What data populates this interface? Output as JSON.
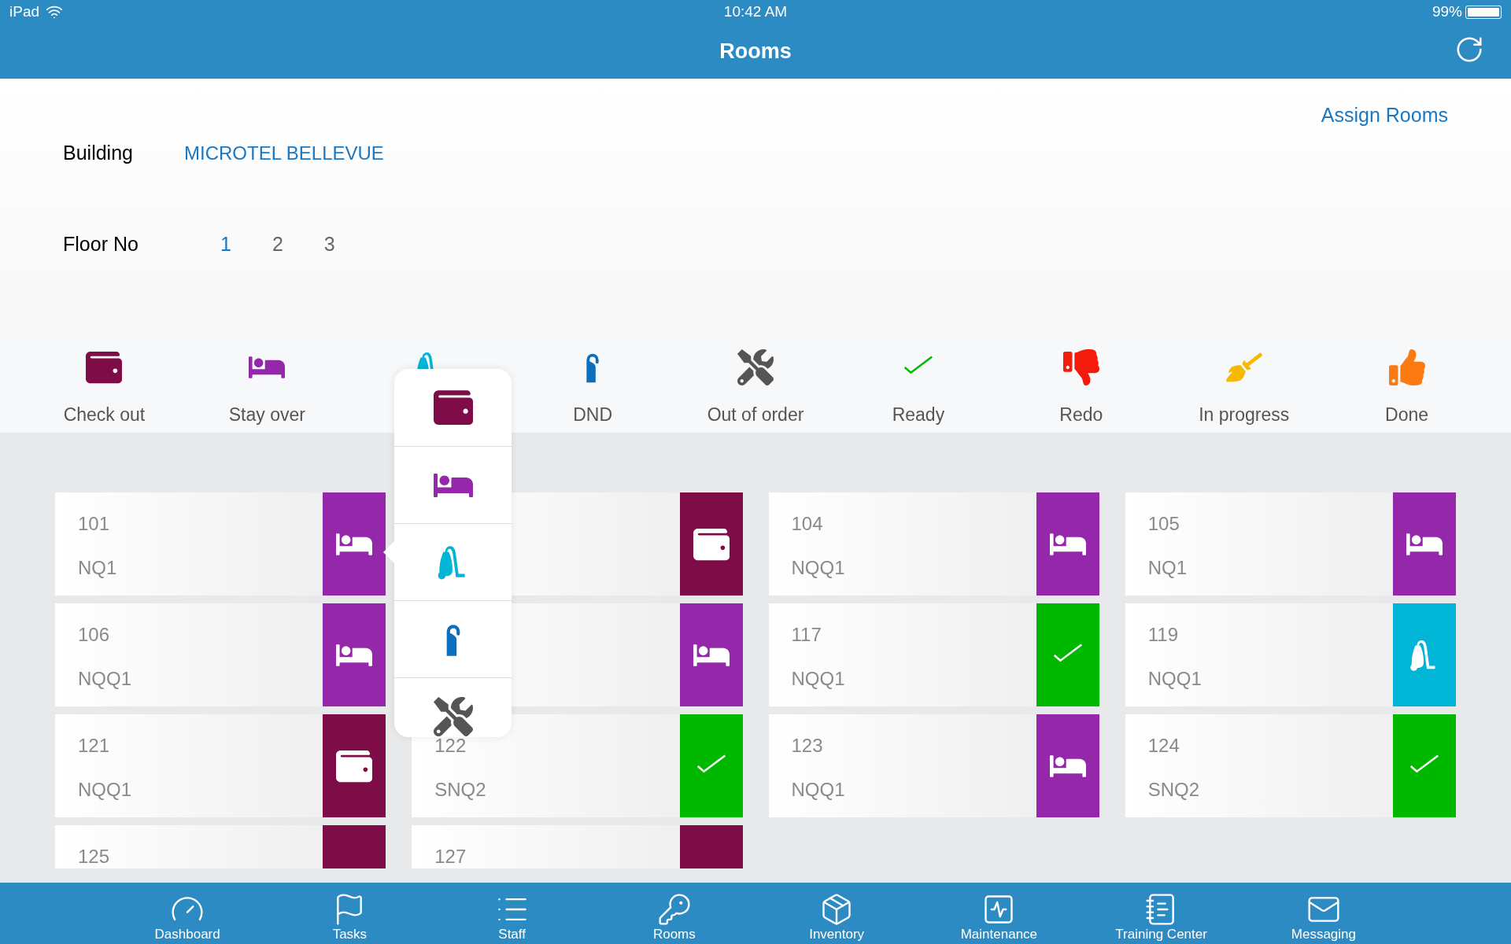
{
  "status_bar": {
    "device": "iPad",
    "time": "10:42 AM",
    "battery": "99%"
  },
  "nav": {
    "title": "Rooms"
  },
  "assign_link": "Assign Rooms",
  "building": {
    "label": "Building",
    "value": "MICROTEL BELLEVUE"
  },
  "floor": {
    "label": "Floor No",
    "options": [
      {
        "label": "1",
        "selected": true
      },
      {
        "label": "2",
        "selected": false
      },
      {
        "label": "3",
        "selected": false
      }
    ]
  },
  "legend": [
    {
      "kind": "checkout",
      "label": "Check out"
    },
    {
      "kind": "stayover",
      "label": "Stay over"
    },
    {
      "kind": "cleaning"
    },
    {
      "kind": "dnd",
      "label": "DND"
    },
    {
      "kind": "out_of_order",
      "label": "Out of order"
    },
    {
      "kind": "ready",
      "label": "Ready"
    },
    {
      "kind": "redo",
      "label": "Redo"
    },
    {
      "kind": "in_progress",
      "label": "In progress"
    },
    {
      "kind": "done",
      "label": "Done"
    }
  ],
  "rooms": [
    {
      "number": "101",
      "type": "NQ1",
      "kind": "stayover"
    },
    {
      "kind": "checkout"
    },
    {
      "number": "104",
      "type": "NQQ1",
      "kind": "stayover"
    },
    {
      "number": "105",
      "type": "NQ1",
      "kind": "stayover"
    },
    {
      "number": "106",
      "type": "NQQ1",
      "kind": "stayover"
    },
    {
      "kind": "stayover"
    },
    {
      "number": "117",
      "type": "NQQ1",
      "kind": "ready"
    },
    {
      "number": "119",
      "type": "NQQ1",
      "kind": "cleaning"
    },
    {
      "number": "121",
      "type": "NQQ1",
      "kind": "checkout"
    },
    {
      "number": "122",
      "type": "SNQ2",
      "kind": "ready"
    },
    {
      "number": "123",
      "type": "NQQ1",
      "kind": "stayover"
    },
    {
      "number": "124",
      "type": "SNQ2",
      "kind": "ready"
    },
    {
      "number": "125",
      "kind": "checkout_cut"
    },
    {
      "number": "127",
      "kind": "checkout_cut"
    }
  ],
  "status_menu": [
    {
      "kind": "checkout"
    },
    {
      "kind": "stayover"
    },
    {
      "kind": "cleaning"
    },
    {
      "kind": "dnd"
    },
    {
      "kind": "out_of_order"
    }
  ],
  "tab_bar": [
    {
      "kind": "dashboard",
      "label": "Dashboard"
    },
    {
      "kind": "tasks",
      "label": "Tasks"
    },
    {
      "kind": "staff",
      "label": "Staff"
    },
    {
      "kind": "rooms",
      "label": "Rooms"
    },
    {
      "kind": "inventory",
      "label": "Inventory"
    },
    {
      "kind": "maintenance",
      "label": "Maintenance"
    },
    {
      "kind": "training",
      "label": "Training Center"
    },
    {
      "kind": "messaging",
      "label": "Messaging"
    }
  ]
}
